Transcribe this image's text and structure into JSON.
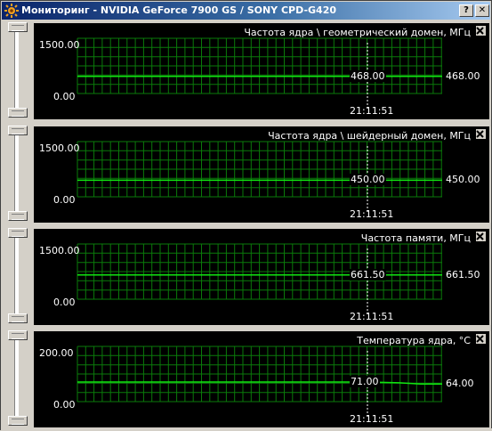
{
  "window": {
    "title": "Мониторинг - NVIDIA GeForce 7900 GS / SONY CPD-G420",
    "help_label": "?",
    "close_label": "✕"
  },
  "colors": {
    "grid": "#0a7a0a",
    "line": "#11e411",
    "background": "#000000",
    "text": "#ffffff"
  },
  "panels": [
    {
      "title": "Частота ядра \\ геометрический домен, МГц",
      "ymax_label": "1500.00",
      "ymin_label": "0.00",
      "ylim": [
        0,
        1500
      ],
      "cursor_value": "468.00",
      "current_value": "468.00",
      "time": "21:11:51",
      "series": [
        468,
        468
      ],
      "slider_top": 0.0,
      "slider_bottom": 1.0
    },
    {
      "title": "Частота ядра \\ шейдерный домен, МГц",
      "ymax_label": "1500.00",
      "ymin_label": "0.00",
      "ylim": [
        0,
        1500
      ],
      "cursor_value": "450.00",
      "current_value": "450.00",
      "time": "21:11:51",
      "series": [
        450,
        450
      ],
      "slider_top": 0.0,
      "slider_bottom": 1.0
    },
    {
      "title": "Частота памяти, МГц",
      "ymax_label": "1500.00",
      "ymin_label": "0.00",
      "ylim": [
        0,
        1500
      ],
      "cursor_value": "661.50",
      "current_value": "661.50",
      "time": "21:11:51",
      "series": [
        661.5,
        661.5
      ],
      "slider_top": 0.0,
      "slider_bottom": 1.0
    },
    {
      "title": "Температура ядра, °С",
      "ymax_label": "200.00",
      "ymin_label": "0.00",
      "ylim": [
        0,
        200
      ],
      "cursor_value": "71.00",
      "current_value": "64.00",
      "time": "21:11:51",
      "series": [
        71,
        71,
        71,
        71,
        71,
        71,
        71,
        71,
        71,
        71,
        71,
        71,
        71,
        71,
        70,
        68,
        64,
        64
      ],
      "slider_top": 0.0,
      "slider_bottom": 1.0
    }
  ]
}
